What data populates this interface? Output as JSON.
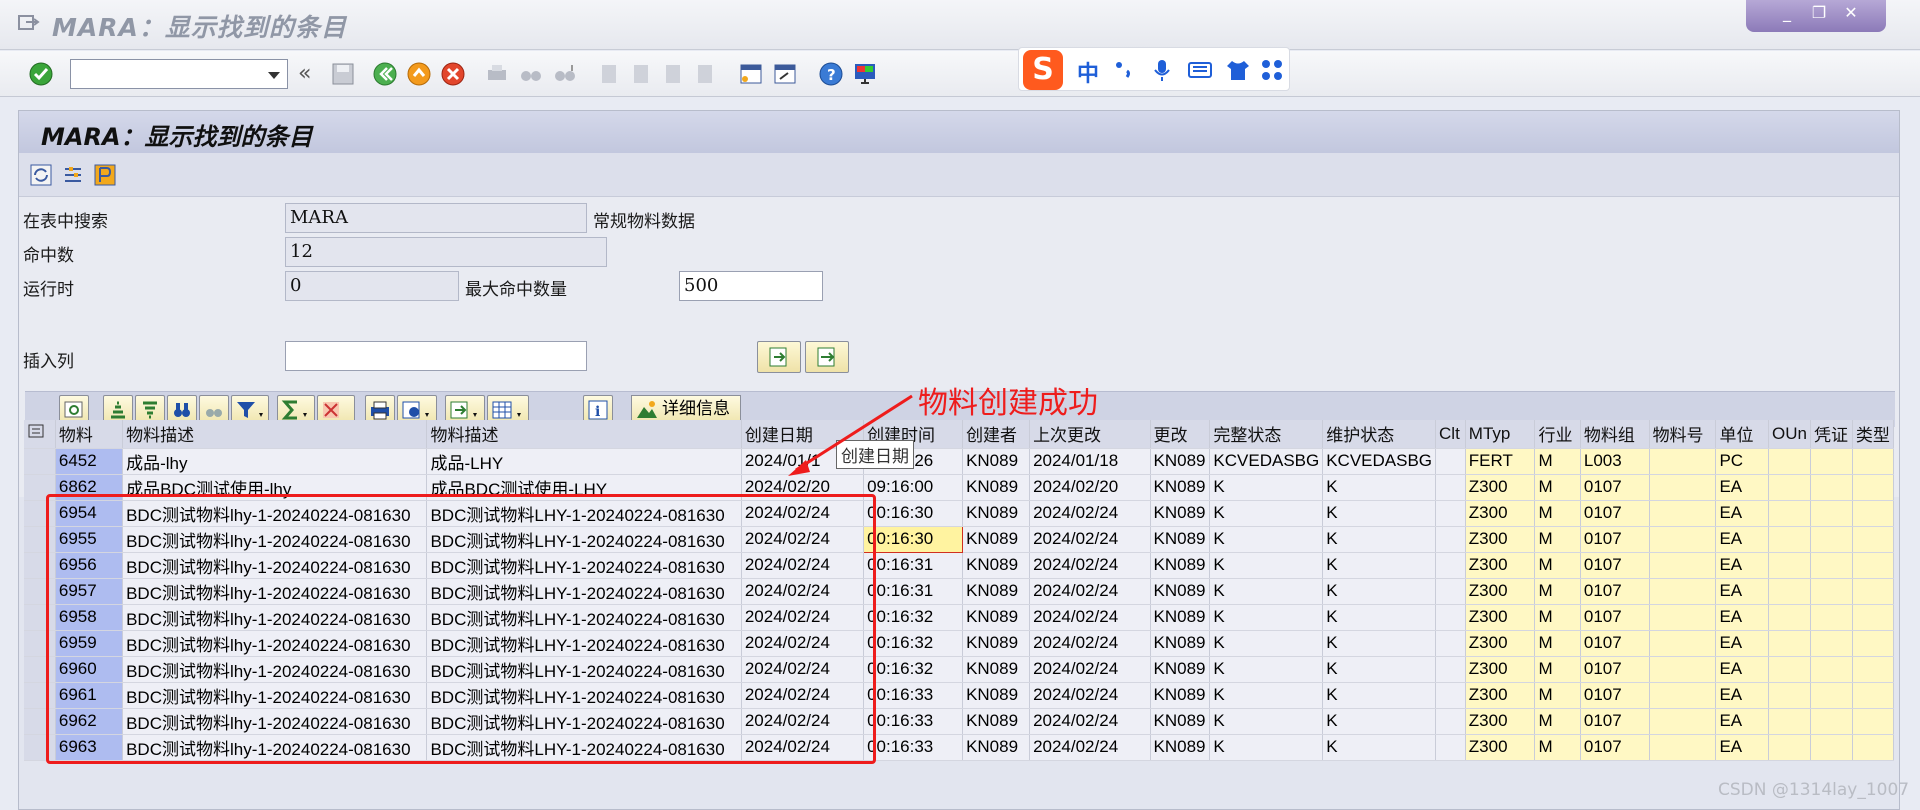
{
  "window": {
    "title": "MARA：显示找到的条目",
    "controls": [
      "_",
      "❐",
      "✕"
    ]
  },
  "standard_toolbar": {
    "command_field_value": "",
    "nav_back_symbol": "«"
  },
  "ime": {
    "logo": "S",
    "lang": "中"
  },
  "screen": {
    "title": "MARA：显示找到的条目"
  },
  "form": {
    "search_label": "在表中搜索",
    "search_value": "MARA",
    "search_desc": "常规物料数据",
    "hits_label": "命中数",
    "hits_value": "12",
    "runtime_label": "运行时",
    "runtime_value": "0",
    "max_hits_label": "最大命中数量",
    "max_hits_value": "500",
    "insert_col_label": "插入列",
    "insert_col_value": ""
  },
  "alv_toolbar": {
    "detail_label": "详细信息"
  },
  "table": {
    "headers": [
      "物料",
      "物料描述",
      "物料描述",
      "创建日期",
      "创建时间",
      "创建者",
      "上次更改",
      "更改",
      "完整状态",
      "维护状态",
      "Clt",
      "MTyp",
      "行业",
      "物料组",
      "物料号",
      "单位",
      "OUn",
      "凭证",
      "类型"
    ],
    "rows": [
      [
        "6452",
        "成品-lhy",
        "成品-LHY",
        "2024/01/1",
        "09:13:26",
        "KN089",
        "2024/01/18",
        "KN089",
        "KCVEDASBG",
        "KCVEDASBG",
        "",
        "FERT",
        "M",
        "L003",
        "",
        "PC",
        "",
        "",
        ""
      ],
      [
        "6862",
        "成品BDC测试使用-lhy",
        "成品BDC测试使用-LHY",
        "2024/02/20",
        "09:16:00",
        "KN089",
        "2024/02/20",
        "KN089",
        "K",
        "K",
        "",
        "Z300",
        "M",
        "0107",
        "",
        "EA",
        "",
        "",
        ""
      ],
      [
        "6954",
        "BDC测试物料lhy-1-20240224-081630",
        "BDC测试物料LHY-1-20240224-081630",
        "2024/02/24",
        "00:16:30",
        "KN089",
        "2024/02/24",
        "KN089",
        "K",
        "K",
        "",
        "Z300",
        "M",
        "0107",
        "",
        "EA",
        "",
        "",
        ""
      ],
      [
        "6955",
        "BDC测试物料lhy-1-20240224-081630",
        "BDC测试物料LHY-1-20240224-081630",
        "2024/02/24",
        "00:16:30",
        "KN089",
        "2024/02/24",
        "KN089",
        "K",
        "K",
        "",
        "Z300",
        "M",
        "0107",
        "",
        "EA",
        "",
        "",
        ""
      ],
      [
        "6956",
        "BDC测试物料lhy-1-20240224-081630",
        "BDC测试物料LHY-1-20240224-081630",
        "2024/02/24",
        "00:16:31",
        "KN089",
        "2024/02/24",
        "KN089",
        "K",
        "K",
        "",
        "Z300",
        "M",
        "0107",
        "",
        "EA",
        "",
        "",
        ""
      ],
      [
        "6957",
        "BDC测试物料lhy-1-20240224-081630",
        "BDC测试物料LHY-1-20240224-081630",
        "2024/02/24",
        "00:16:31",
        "KN089",
        "2024/02/24",
        "KN089",
        "K",
        "K",
        "",
        "Z300",
        "M",
        "0107",
        "",
        "EA",
        "",
        "",
        ""
      ],
      [
        "6958",
        "BDC测试物料lhy-1-20240224-081630",
        "BDC测试物料LHY-1-20240224-081630",
        "2024/02/24",
        "00:16:32",
        "KN089",
        "2024/02/24",
        "KN089",
        "K",
        "K",
        "",
        "Z300",
        "M",
        "0107",
        "",
        "EA",
        "",
        "",
        ""
      ],
      [
        "6959",
        "BDC测试物料lhy-1-20240224-081630",
        "BDC测试物料LHY-1-20240224-081630",
        "2024/02/24",
        "00:16:32",
        "KN089",
        "2024/02/24",
        "KN089",
        "K",
        "K",
        "",
        "Z300",
        "M",
        "0107",
        "",
        "EA",
        "",
        "",
        ""
      ],
      [
        "6960",
        "BDC测试物料lhy-1-20240224-081630",
        "BDC测试物料LHY-1-20240224-081630",
        "2024/02/24",
        "00:16:32",
        "KN089",
        "2024/02/24",
        "KN089",
        "K",
        "K",
        "",
        "Z300",
        "M",
        "0107",
        "",
        "EA",
        "",
        "",
        ""
      ],
      [
        "6961",
        "BDC测试物料lhy-1-20240224-081630",
        "BDC测试物料LHY-1-20240224-081630",
        "2024/02/24",
        "00:16:33",
        "KN089",
        "2024/02/24",
        "KN089",
        "K",
        "K",
        "",
        "Z300",
        "M",
        "0107",
        "",
        "EA",
        "",
        "",
        ""
      ],
      [
        "6962",
        "BDC测试物料lhy-1-20240224-081630",
        "BDC测试物料LHY-1-20240224-081630",
        "2024/02/24",
        "00:16:33",
        "KN089",
        "2024/02/24",
        "KN089",
        "K",
        "K",
        "",
        "Z300",
        "M",
        "0107",
        "",
        "EA",
        "",
        "",
        ""
      ],
      [
        "6963",
        "BDC测试物料lhy-1-20240224-081630",
        "BDC测试物料LHY-1-20240224-081630",
        "2024/02/24",
        "00:16:33",
        "KN089",
        "2024/02/24",
        "KN089",
        "K",
        "K",
        "",
        "Z300",
        "M",
        "0107",
        "",
        "EA",
        "",
        "",
        ""
      ]
    ],
    "tooltip": "创建日期"
  },
  "annotation": {
    "text": "物料创建成功",
    "color": "#ee1c1c"
  },
  "watermark": "CSDN @1314lay_1007"
}
